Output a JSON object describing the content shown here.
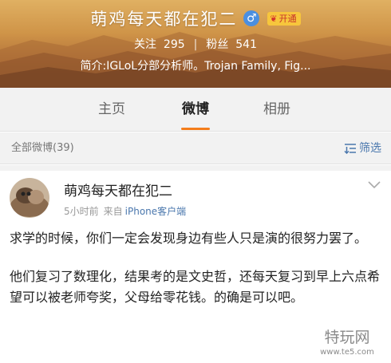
{
  "profile": {
    "name": "萌鸡每天都在犯二",
    "gender_icon": "male-symbol-icon",
    "gender_symbol": "♂",
    "vip_icon": "vip-crown-icon",
    "vip_symbol": "❦",
    "vip_label": "开通",
    "following_label": "关注",
    "following_count": "295",
    "followers_label": "粉丝",
    "followers_count": "541",
    "bio": "简介:IGLoL分部分析师。Trojan Family, Fig...",
    "separator": "|"
  },
  "tabs": [
    {
      "label": "主页",
      "active": false
    },
    {
      "label": "微博",
      "active": true
    },
    {
      "label": "相册",
      "active": false
    }
  ],
  "filter_bar": {
    "all_posts": "全部微博(39)",
    "filter_label": "筛选",
    "filter_icon": "sort-filter-icon"
  },
  "post": {
    "author": "萌鸡每天都在犯二",
    "time": "5小时前",
    "source_label": "来自",
    "source": "iPhone客户端",
    "menu_icon": "chevron-down-icon",
    "paragraphs": [
      "求学的时候，你们一定会发现身边有些人只是演的很努力罢了。",
      "他们复习了数理化，结果考的是文史哲，还每天复习到早上六点希望可以被老师夸奖，父母给零花钱。的确是可以吧。"
    ]
  },
  "watermark": {
    "text": "特玩网",
    "url": "www.te5.com"
  },
  "colors": {
    "accent": "#f47d1b",
    "link": "#4a77ad",
    "background_gray": "#f2f2f2",
    "male_badge": "#4b8fe0",
    "vip_badge": "#f7c63c"
  }
}
